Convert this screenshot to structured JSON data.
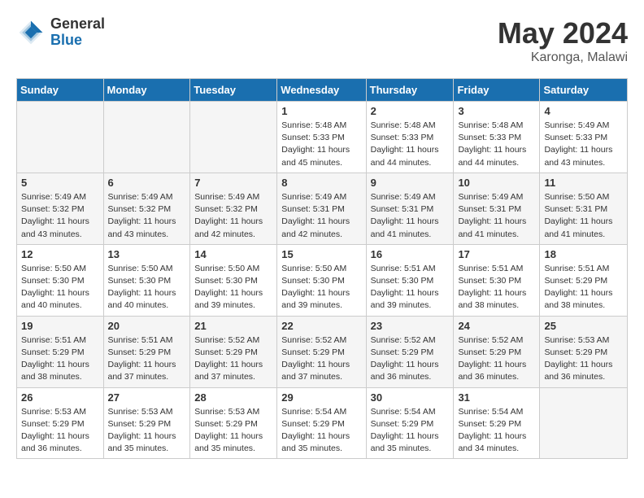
{
  "header": {
    "logo_general": "General",
    "logo_blue": "Blue",
    "month": "May 2024",
    "location": "Karonga, Malawi"
  },
  "days_of_week": [
    "Sunday",
    "Monday",
    "Tuesday",
    "Wednesday",
    "Thursday",
    "Friday",
    "Saturday"
  ],
  "weeks": [
    [
      {
        "day": "",
        "info": ""
      },
      {
        "day": "",
        "info": ""
      },
      {
        "day": "",
        "info": ""
      },
      {
        "day": "1",
        "info": "Sunrise: 5:48 AM\nSunset: 5:33 PM\nDaylight: 11 hours\nand 45 minutes."
      },
      {
        "day": "2",
        "info": "Sunrise: 5:48 AM\nSunset: 5:33 PM\nDaylight: 11 hours\nand 44 minutes."
      },
      {
        "day": "3",
        "info": "Sunrise: 5:48 AM\nSunset: 5:33 PM\nDaylight: 11 hours\nand 44 minutes."
      },
      {
        "day": "4",
        "info": "Sunrise: 5:49 AM\nSunset: 5:33 PM\nDaylight: 11 hours\nand 43 minutes."
      }
    ],
    [
      {
        "day": "5",
        "info": "Sunrise: 5:49 AM\nSunset: 5:32 PM\nDaylight: 11 hours\nand 43 minutes."
      },
      {
        "day": "6",
        "info": "Sunrise: 5:49 AM\nSunset: 5:32 PM\nDaylight: 11 hours\nand 43 minutes."
      },
      {
        "day": "7",
        "info": "Sunrise: 5:49 AM\nSunset: 5:32 PM\nDaylight: 11 hours\nand 42 minutes."
      },
      {
        "day": "8",
        "info": "Sunrise: 5:49 AM\nSunset: 5:31 PM\nDaylight: 11 hours\nand 42 minutes."
      },
      {
        "day": "9",
        "info": "Sunrise: 5:49 AM\nSunset: 5:31 PM\nDaylight: 11 hours\nand 41 minutes."
      },
      {
        "day": "10",
        "info": "Sunrise: 5:49 AM\nSunset: 5:31 PM\nDaylight: 11 hours\nand 41 minutes."
      },
      {
        "day": "11",
        "info": "Sunrise: 5:50 AM\nSunset: 5:31 PM\nDaylight: 11 hours\nand 41 minutes."
      }
    ],
    [
      {
        "day": "12",
        "info": "Sunrise: 5:50 AM\nSunset: 5:30 PM\nDaylight: 11 hours\nand 40 minutes."
      },
      {
        "day": "13",
        "info": "Sunrise: 5:50 AM\nSunset: 5:30 PM\nDaylight: 11 hours\nand 40 minutes."
      },
      {
        "day": "14",
        "info": "Sunrise: 5:50 AM\nSunset: 5:30 PM\nDaylight: 11 hours\nand 39 minutes."
      },
      {
        "day": "15",
        "info": "Sunrise: 5:50 AM\nSunset: 5:30 PM\nDaylight: 11 hours\nand 39 minutes."
      },
      {
        "day": "16",
        "info": "Sunrise: 5:51 AM\nSunset: 5:30 PM\nDaylight: 11 hours\nand 39 minutes."
      },
      {
        "day": "17",
        "info": "Sunrise: 5:51 AM\nSunset: 5:30 PM\nDaylight: 11 hours\nand 38 minutes."
      },
      {
        "day": "18",
        "info": "Sunrise: 5:51 AM\nSunset: 5:29 PM\nDaylight: 11 hours\nand 38 minutes."
      }
    ],
    [
      {
        "day": "19",
        "info": "Sunrise: 5:51 AM\nSunset: 5:29 PM\nDaylight: 11 hours\nand 38 minutes."
      },
      {
        "day": "20",
        "info": "Sunrise: 5:51 AM\nSunset: 5:29 PM\nDaylight: 11 hours\nand 37 minutes."
      },
      {
        "day": "21",
        "info": "Sunrise: 5:52 AM\nSunset: 5:29 PM\nDaylight: 11 hours\nand 37 minutes."
      },
      {
        "day": "22",
        "info": "Sunrise: 5:52 AM\nSunset: 5:29 PM\nDaylight: 11 hours\nand 37 minutes."
      },
      {
        "day": "23",
        "info": "Sunrise: 5:52 AM\nSunset: 5:29 PM\nDaylight: 11 hours\nand 36 minutes."
      },
      {
        "day": "24",
        "info": "Sunrise: 5:52 AM\nSunset: 5:29 PM\nDaylight: 11 hours\nand 36 minutes."
      },
      {
        "day": "25",
        "info": "Sunrise: 5:53 AM\nSunset: 5:29 PM\nDaylight: 11 hours\nand 36 minutes."
      }
    ],
    [
      {
        "day": "26",
        "info": "Sunrise: 5:53 AM\nSunset: 5:29 PM\nDaylight: 11 hours\nand 36 minutes."
      },
      {
        "day": "27",
        "info": "Sunrise: 5:53 AM\nSunset: 5:29 PM\nDaylight: 11 hours\nand 35 minutes."
      },
      {
        "day": "28",
        "info": "Sunrise: 5:53 AM\nSunset: 5:29 PM\nDaylight: 11 hours\nand 35 minutes."
      },
      {
        "day": "29",
        "info": "Sunrise: 5:54 AM\nSunset: 5:29 PM\nDaylight: 11 hours\nand 35 minutes."
      },
      {
        "day": "30",
        "info": "Sunrise: 5:54 AM\nSunset: 5:29 PM\nDaylight: 11 hours\nand 35 minutes."
      },
      {
        "day": "31",
        "info": "Sunrise: 5:54 AM\nSunset: 5:29 PM\nDaylight: 11 hours\nand 34 minutes."
      },
      {
        "day": "",
        "info": ""
      }
    ]
  ]
}
